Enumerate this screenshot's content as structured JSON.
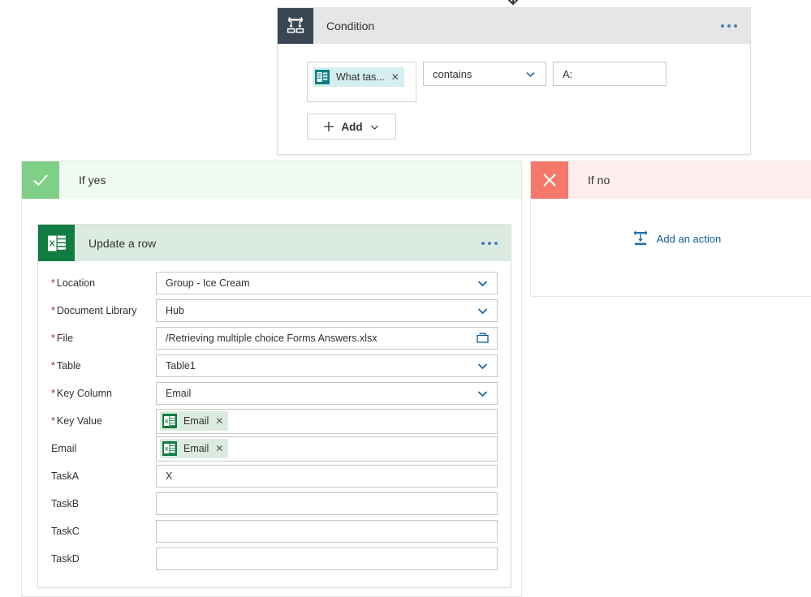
{
  "canvas": {
    "top_connector_icon": "down-arrow-icon"
  },
  "condition": {
    "icon": "condition-branch-icon",
    "title": "Condition",
    "menu_icon": "ellipsis-icon",
    "operand_left": {
      "icon": "microsoft-forms-icon",
      "label": "What tas...",
      "remove_icon": "close-icon"
    },
    "operator": {
      "value": "contains",
      "chevron_icon": "chevron-down-icon"
    },
    "operand_right": {
      "value": "A:"
    },
    "add_button": {
      "label": "Add",
      "plus_icon": "plus-icon",
      "chevron_icon": "chevron-down-icon"
    }
  },
  "branch_yes": {
    "label": "If yes",
    "badge_icon": "checkmark-icon"
  },
  "branch_no": {
    "label": "If no",
    "badge_icon": "close-x-icon",
    "add_action": {
      "label": "Add an action",
      "icon": "add-action-icon"
    }
  },
  "action_card": {
    "icon": "excel-icon",
    "title": "Update a row",
    "menu_icon": "ellipsis-icon",
    "fields": [
      {
        "label": "Location",
        "required": true,
        "type": "select",
        "value": "Group - Ice Cream"
      },
      {
        "label": "Document Library",
        "required": true,
        "type": "select",
        "value": "Hub"
      },
      {
        "label": "File",
        "required": true,
        "type": "file",
        "value": "/Retrieving multiple choice Forms Answers.xlsx"
      },
      {
        "label": "Table",
        "required": true,
        "type": "select",
        "value": "Table1"
      },
      {
        "label": "Key Column",
        "required": true,
        "type": "select",
        "value": "Email"
      },
      {
        "label": "Key Value",
        "required": true,
        "type": "token",
        "value": "Email",
        "token_icon": "excel-icon",
        "remove_icon": "close-icon"
      },
      {
        "label": "Email",
        "required": false,
        "type": "token",
        "value": "Email",
        "token_icon": "excel-icon",
        "remove_icon": "close-icon"
      },
      {
        "label": "TaskA",
        "required": false,
        "type": "text",
        "value": "X"
      },
      {
        "label": "TaskB",
        "required": false,
        "type": "text",
        "value": ""
      },
      {
        "label": "TaskC",
        "required": false,
        "type": "text",
        "value": ""
      },
      {
        "label": "TaskD",
        "required": false,
        "type": "text",
        "value": ""
      }
    ]
  },
  "colors": {
    "condition_header": "#e6e6e6",
    "condition_icon_bg": "#3b4654",
    "yes_badge": "#7fcf86",
    "yes_header": "#effaf0",
    "no_badge": "#f4796b",
    "no_header": "#fdeeed",
    "excel_green": "#107c41",
    "action_header": "#dcebe2",
    "forms_teal": "#0f7c84",
    "link_blue": "#0b5c9e",
    "required_red": "#a4262c"
  }
}
